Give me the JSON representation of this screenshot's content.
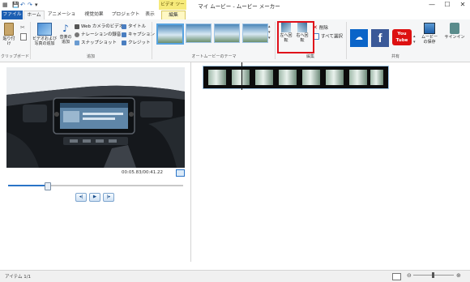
{
  "window": {
    "title": "マイ ムービー - ムービー メーカー",
    "context_tab_label": "ビデオ ツール",
    "controls": {
      "minimize": "—",
      "maximize": "☐",
      "close": "✕"
    },
    "quick_access": {
      "save": "💾",
      "undo": "↶",
      "redo": "↷",
      "dropdown": "▾"
    }
  },
  "tabs": [
    {
      "label": "ファイル"
    },
    {
      "label": "ホーム"
    },
    {
      "label": "アニメーション"
    },
    {
      "label": "視覚効果"
    },
    {
      "label": "プロジェクト"
    },
    {
      "label": "表示"
    },
    {
      "label": "編集"
    }
  ],
  "ribbon": {
    "clipboard": {
      "paste_label": "貼り付け",
      "group_label": "クリップボード"
    },
    "add": {
      "add_videos_label": "ビデオおよび写真の追加",
      "add_music_label": "音楽の追加",
      "webcam_label": "Web カメラのビデオ",
      "narration_label": "ナレーションの録音",
      "snapshot_label": "スナップショット",
      "title_label": "タイトル",
      "caption_label": "キャプション",
      "credits_label": "クレジット",
      "group_label": "追加"
    },
    "themes": {
      "group_label": "オートムービーのテーマ"
    },
    "editing": {
      "rotate_left_label": "左へ回転",
      "rotate_right_label": "右へ回転",
      "delete_label": "削除",
      "select_all_label": "すべて選択",
      "group_label": "編集"
    },
    "share": {
      "youtube_label": "You Tube",
      "save_movie_label": "ムービーの保存",
      "signin_label": "サインイン",
      "group_label": "共有"
    }
  },
  "player": {
    "timecode": "00:05.83/00:41.22",
    "prev_frame": "◂|",
    "play": "▶",
    "next_frame": "|▸"
  },
  "status": {
    "items_text": "アイテム 1/1"
  },
  "colors": {
    "file_tab": "#1c5fb3",
    "highlight_box": "#e0101a",
    "accent_blue": "#2a74c7"
  }
}
